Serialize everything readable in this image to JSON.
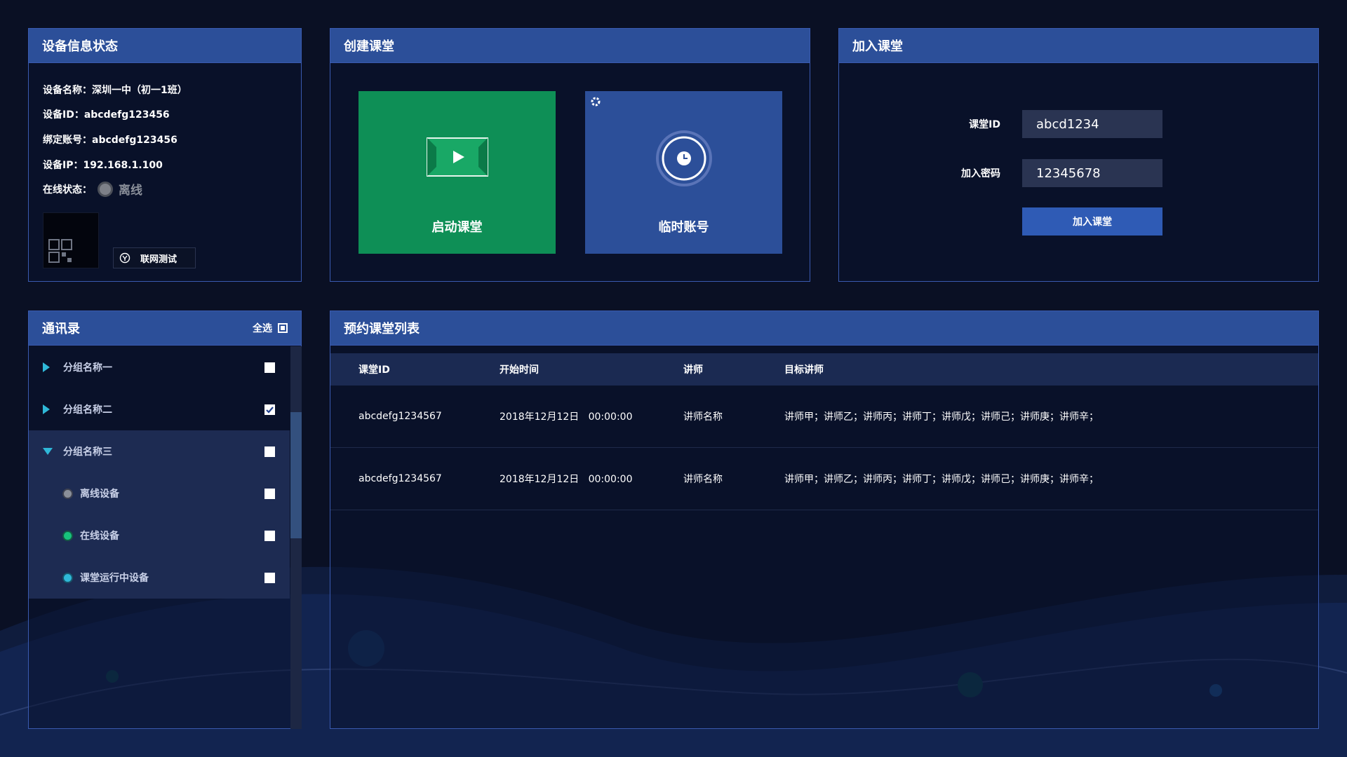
{
  "device": {
    "title": "设备信息状态",
    "name_line": "设备名称：深圳一中（初一1班）",
    "id_line": "设备ID：abcdefg123456",
    "account_line": "绑定账号：abcdefg123456",
    "ip_line": "设备IP：192.168.1.100",
    "online_label": "在线状态：",
    "online_value": "离线",
    "network_test": "联网测试"
  },
  "create": {
    "title": "创建课堂",
    "start_label": "启动课堂",
    "temp_label": "临时账号"
  },
  "join": {
    "title": "加入课堂",
    "id_label": "课堂ID",
    "id_value": "abcd1234",
    "password_label": "加入密码",
    "password_value": "12345678",
    "button": "加入课堂"
  },
  "contacts": {
    "title": "通讯录",
    "select_all": "全选",
    "groups": [
      {
        "label": "分组名称一",
        "checked": false
      },
      {
        "label": "分组名称二",
        "checked": true
      },
      {
        "label": "分组名称三",
        "checked": false
      }
    ],
    "devices": [
      {
        "label": "离线设备",
        "color": "#8a8f99"
      },
      {
        "label": "在线设备",
        "color": "#17c27c"
      },
      {
        "label": "课堂运行中设备",
        "color": "#2fb8d8"
      }
    ]
  },
  "schedule": {
    "title": "预约课堂列表",
    "headers": [
      "课堂ID",
      "开始时间",
      "讲师",
      "目标讲师"
    ],
    "rows": [
      [
        "abcdefg1234567",
        "2018年12月12日   00:00:00",
        "讲师名称",
        "讲师甲；讲师乙；讲师丙；讲师丁；讲师戊；讲师己；讲师庚；讲师辛；"
      ],
      [
        "abcdefg1234567",
        "2018年12月12日   00:00:00",
        "讲师名称",
        "讲师甲；讲师乙；讲师丙；讲师丁；讲师戊；讲师己；讲师庚；讲师辛；"
      ]
    ]
  },
  "colors": {
    "background": "#0a1024",
    "panel_header": "#2c4f99",
    "start_tile": "#0e8f56",
    "temp_tile": "#2c4f99",
    "join_button": "#2f5bb5"
  }
}
